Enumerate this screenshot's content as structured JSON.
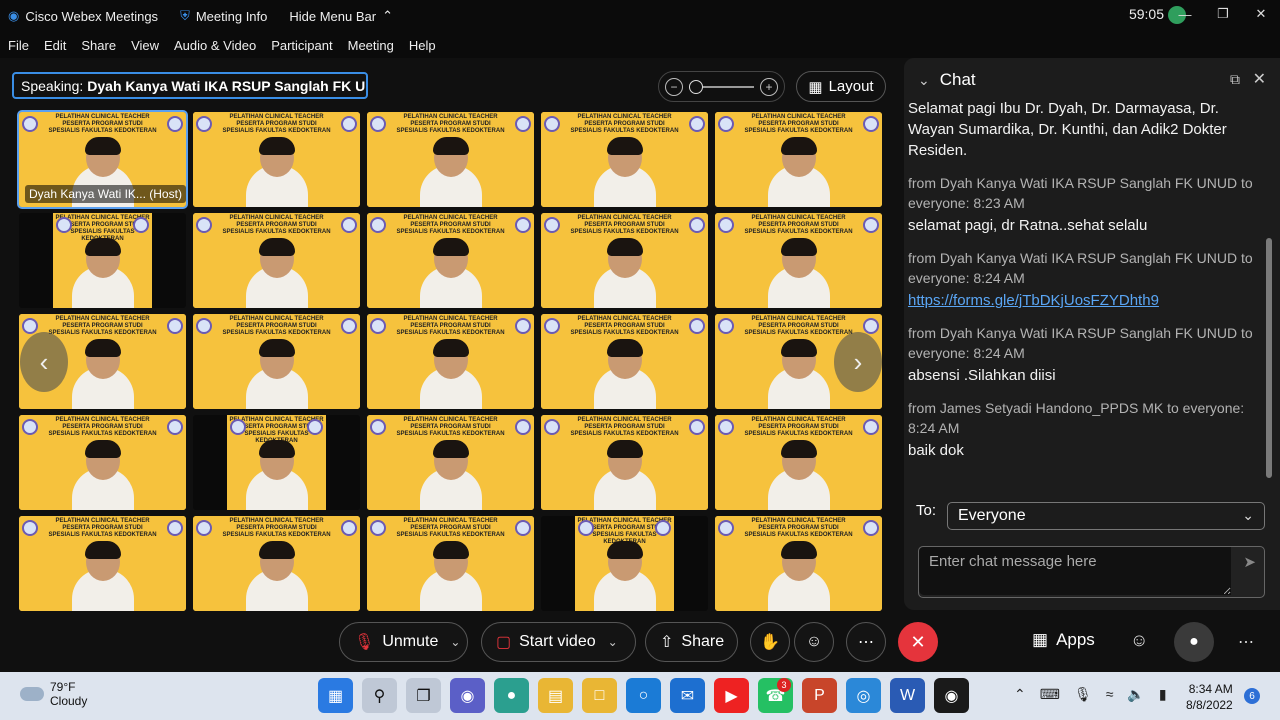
{
  "titlebar": {
    "app_name": "Cisco Webex Meetings",
    "meeting_info": "Meeting Info",
    "hide_menu": "Hide Menu Bar",
    "timer": "59:05"
  },
  "menu": [
    "File",
    "Edit",
    "Share",
    "View",
    "Audio & Video",
    "Participant",
    "Meeting",
    "Help"
  ],
  "speaking": {
    "label": "Speaking:",
    "name": "Dyah Kanya Wati IKA RSUP Sanglah FK U..."
  },
  "layout_button": "Layout",
  "tiles": {
    "banner_line1": "PELATIHAN CLINICAL TEACHER",
    "banner_line2": "PESERTA PROGRAM STUDI",
    "banner_line3": "SPESIALIS FAKULTAS KEDOKTERAN",
    "host_tag": "Dyah Kanya Wati IK... (Host)"
  },
  "chat": {
    "title": "Chat",
    "messages": [
      {
        "meta": "",
        "text": "Selamat pagi Ibu Dr. Dyah, Dr. Darmayasa, Dr. Wayan Sumardika, Dr. Kunthi, dan Adik2 Dokter Residen."
      },
      {
        "meta": "from Dyah Kanya Wati IKA RSUP Sanglah FK UNUD to everyone:    8:23 AM",
        "text": "selamat pagi, dr Ratna..sehat selalu"
      },
      {
        "meta": "from Dyah Kanya Wati IKA RSUP Sanglah FK UNUD to everyone:    8:24 AM",
        "link": "https://forms.gle/jTbDKjUosFZYDhth9"
      },
      {
        "meta": "from Dyah Kanya Wati IKA RSUP Sanglah FK UNUD to everyone:    8:24 AM",
        "text": "absensi .Silahkan diisi"
      },
      {
        "meta": "from James Setyadi Handono_PPDS MK to everyone: 8:24 AM",
        "text": "baik dok"
      }
    ],
    "to_label": "To:",
    "to_value": "Everyone",
    "input_placeholder": "Enter chat message here"
  },
  "controls": {
    "unmute": "Unmute",
    "start_video": "Start video",
    "share": "Share",
    "apps": "Apps"
  },
  "taskbar": {
    "temperature": "79°F",
    "weather": "Cloudy",
    "time": "8:34 AM",
    "date": "8/8/2022",
    "whatsapp_badge": "3",
    "notifications": "6"
  }
}
